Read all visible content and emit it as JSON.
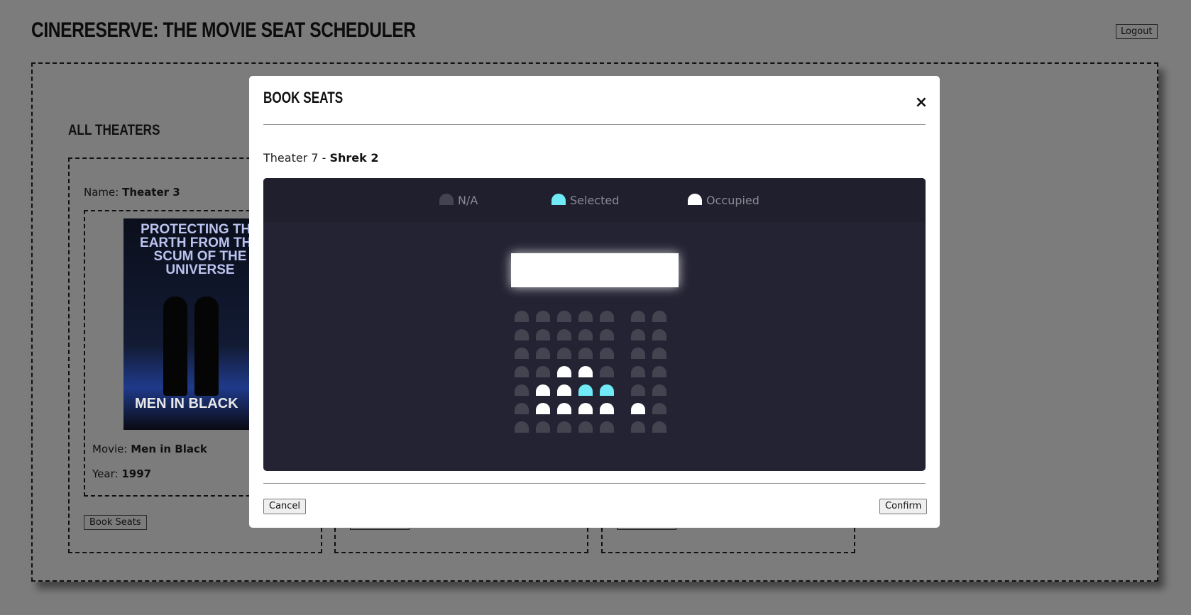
{
  "app": {
    "title": "CineReserve: The Movie Seat Scheduler",
    "logout_label": "Logout"
  },
  "theaters_section": {
    "title": "All Theaters",
    "cards": [
      {
        "name_label": "Name:",
        "name": "Theater 3",
        "poster": {
          "tagline": "PROTECTING THE EARTH FROM THE SCUM OF THE UNIVERSE",
          "title_text": "MEN IN BLACK"
        },
        "movie_label": "Movie:",
        "movie": "Men in Black",
        "year_label": "Year:",
        "year": "1997",
        "book_label": "Book Seats"
      }
    ]
  },
  "modal": {
    "title": "Book Seats",
    "close_icon": "×",
    "theater": "Theater 7",
    "separator": " - ",
    "movie": "Shrek 2",
    "legend": [
      {
        "status": "na",
        "label": "N/A"
      },
      {
        "status": "selected",
        "label": "Selected"
      },
      {
        "status": "occupied",
        "label": "Occupied"
      }
    ],
    "seat_colors": {
      "na": "#444451",
      "selected": "#6feaf6",
      "occupied": "#ffffff"
    },
    "seat_rows": [
      [
        "na",
        "na",
        "na",
        "na",
        "na",
        "na",
        "na"
      ],
      [
        "na",
        "na",
        "na",
        "na",
        "na",
        "na",
        "na"
      ],
      [
        "na",
        "na",
        "na",
        "na",
        "na",
        "na",
        "na"
      ],
      [
        "na",
        "na",
        "occupied",
        "occupied",
        "na",
        "na",
        "na"
      ],
      [
        "na",
        "occupied",
        "occupied",
        "selected",
        "selected",
        "na",
        "na"
      ],
      [
        "na",
        "occupied",
        "occupied",
        "occupied",
        "occupied",
        "occupied",
        "na"
      ],
      [
        "na",
        "na",
        "na",
        "na",
        "na",
        "na",
        "na"
      ]
    ],
    "cancel_label": "Cancel",
    "confirm_label": "Confirm"
  }
}
